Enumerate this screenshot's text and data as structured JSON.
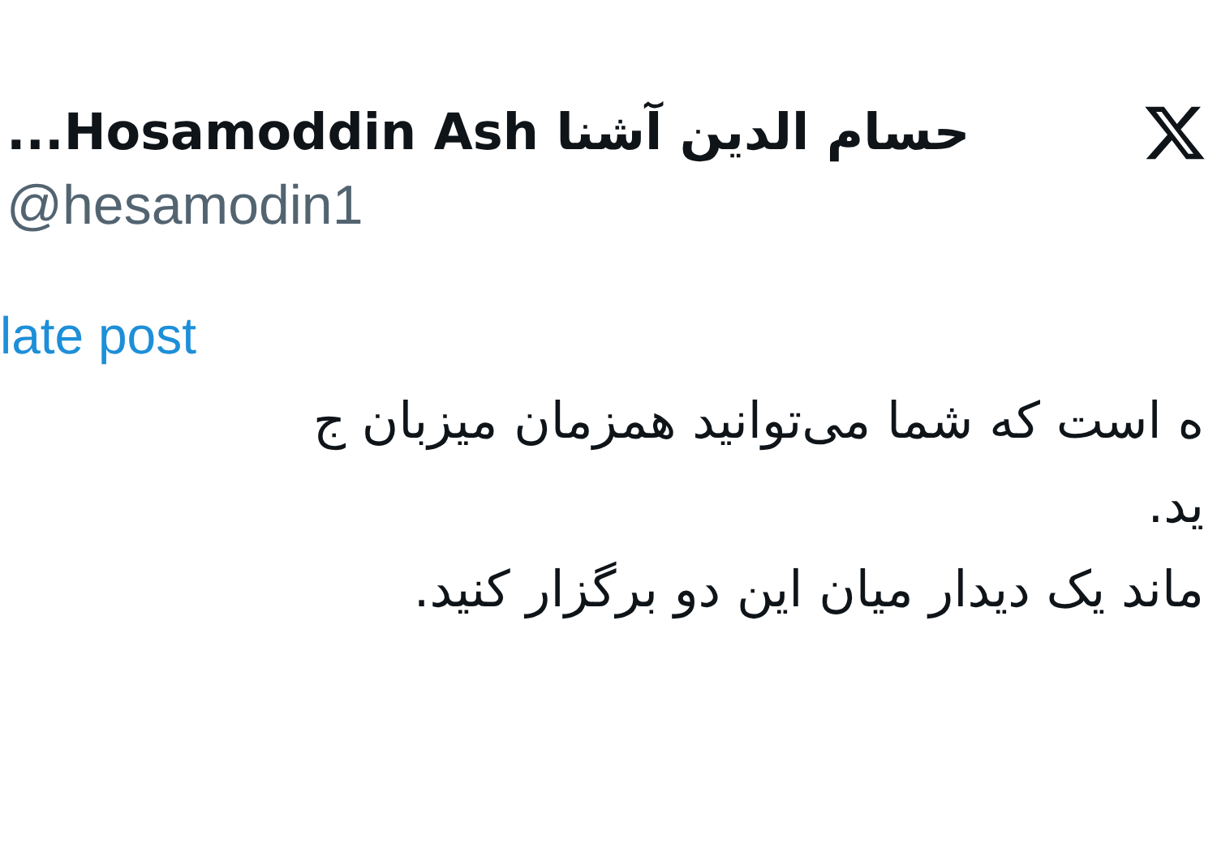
{
  "post": {
    "author_name": "حسام الدین آشنا Hosamoddin Ash...",
    "handle": "@hesamodin1",
    "translate_link": "late post",
    "text_lines": [
      "ه است که شما می‌توانید همزمان میزبان ج",
      "ید.",
      "ماند یک دیدار میان این دو برگزار کنید."
    ]
  }
}
